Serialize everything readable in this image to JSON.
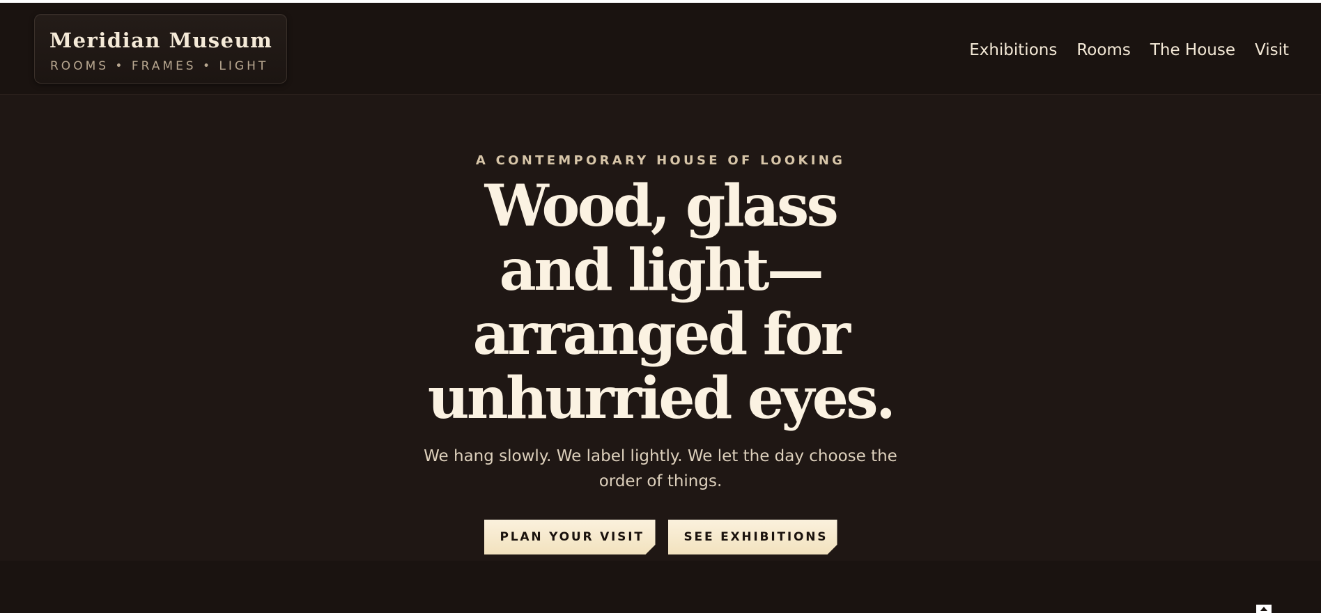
{
  "brand": {
    "name": "Meridian Museum",
    "tagline": "ROOMS • FRAMES • LIGHT"
  },
  "nav": {
    "items": [
      {
        "label": "Exhibitions"
      },
      {
        "label": "Rooms"
      },
      {
        "label": "The House"
      },
      {
        "label": "Visit"
      }
    ]
  },
  "hero": {
    "kicker": "A CONTEMPORARY HOUSE OF LOOKING",
    "headline_lines": [
      "Wood, glass",
      "and light—",
      "arranged for",
      "unhurried eyes."
    ],
    "lede": "We hang slowly. We label lightly. We let the day choose the order of things.",
    "buttons": {
      "primary": "PLAN YOUR VISIT",
      "secondary": "SEE EXHIBITIONS"
    }
  },
  "colors": {
    "background": "#1f1714",
    "header_background": "#1a1310",
    "text_cream": "#fbf2e2",
    "button_cream": "#f5e7c8"
  },
  "icons": {
    "scroll_top": "chevron-up-icon"
  }
}
